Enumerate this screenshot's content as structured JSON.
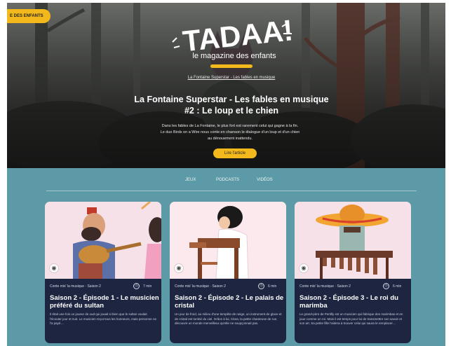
{
  "hero": {
    "badge": "E DES ENFANTS",
    "logo_text": "TADAA!",
    "tagline": "le magazine des enfants",
    "breadcrumb": "La Fontaine Superstar - Les fables en musique",
    "title": "La Fontaine Superstar - Les fables en musique #2 : Le loup et le chien",
    "description": "Dans les fables de La Fontaine, le plus fort est rarement celui qui gagne à la fin. Le duo Birds on a Wire nous conte en chanson le dialogue d'un loup et d'un chien au dénouement inattendu.",
    "button_label": "Lire l'article"
  },
  "tabs": [
    {
      "label": "JEUX"
    },
    {
      "label": "PODCASTS"
    },
    {
      "label": "VIDÉOS"
    }
  ],
  "cards": [
    {
      "category": "Conte mis' la musique · Saison 2",
      "duration": "7 min",
      "title": "Saison 2 - Épisode 1 - Le musicien préféré du sultan",
      "description": "Il était une fois un joueur de oud qui jouait si bien que le sultan voulait l'écouter jour et nuit. Le musicien reçut tous les honneurs, mais personne ne l'a payé…",
      "icon": "microphone-icon"
    },
    {
      "category": "Conte mis' la musique · Saison 2",
      "duration": "6 min",
      "title": "Saison 2 - Épisode 2 - Le palais de cristal",
      "description": "Un jour de froid, au milieu d'une tempête de neige, un instrument de glace et de cristal est tombé du ciel. Grâce à lui, Clara, la petite chanteuse de rue, découvre un monde merveilleux qu'elle ne soupçonnait pas.",
      "icon": "microphone-icon"
    },
    {
      "category": "Conte mis' la musique · Saison 2",
      "duration": "6 min",
      "title": "Saison 2 - Épisode 3 - Le roi du marimba",
      "description": "Le grand-père de Pertilly est un musicien qui fabrique des marimbas et en joue comme un roi. Mais il est temps pour lui de transmettre son savoir et son art. Sa petite fille l'aidera à trouver celui qui saura le remplacer…",
      "icon": "microphone-icon"
    }
  ],
  "colors": {
    "accent": "#f2b81c",
    "section_bg": "#5b9aa6",
    "card_bg": "#1d2541",
    "card_art_bg": "#f6e1e8"
  }
}
